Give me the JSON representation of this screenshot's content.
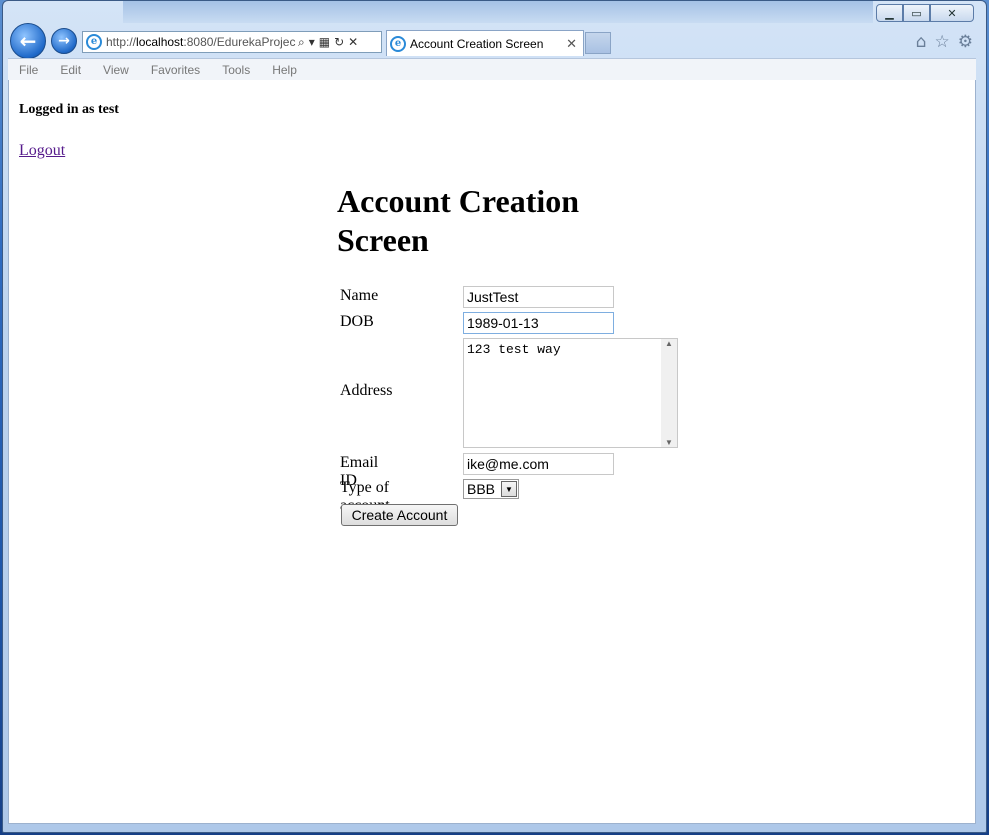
{
  "browser": {
    "url_prefix": "http://",
    "url_host": "localhost",
    "url_rest": ":8080/EdurekaProjec",
    "tab_title": "Account Creation Screen",
    "menu": [
      "File",
      "Edit",
      "View",
      "Favorites",
      "Tools",
      "Help"
    ],
    "window_buttons": {
      "minimize": "▁",
      "maximize": "▭",
      "close": "✕"
    }
  },
  "page": {
    "logged_in": "Logged in as test",
    "logout": "Logout",
    "heading": "Account Creation Screen",
    "form": {
      "name_label": "Name",
      "name_value": "JustTest",
      "dob_label": "DOB",
      "dob_value": "1989-01-13",
      "address_label": "Address",
      "address_value": "123 test way",
      "email_label": "Email ID",
      "email_value": "ike@me.com",
      "type_label": "Type of account",
      "type_value": "BBB",
      "submit_label": "Create Account"
    }
  },
  "colors": {
    "link_visited": "#551a8b",
    "focus_border": "#7eaee0",
    "chrome_blue": "#1f69c9"
  }
}
